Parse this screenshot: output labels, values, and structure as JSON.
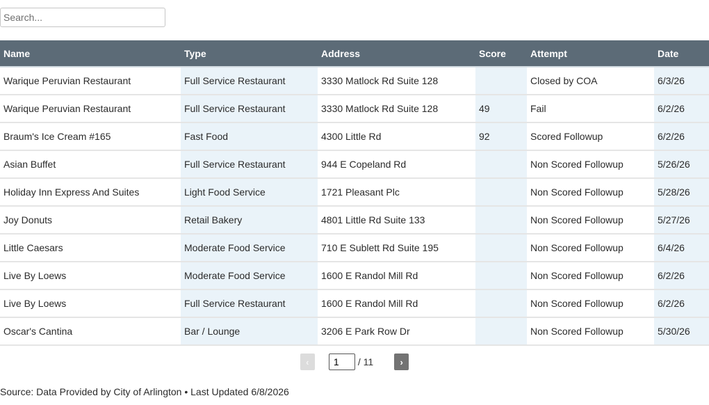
{
  "search": {
    "placeholder": "Search..."
  },
  "table": {
    "headers": [
      "Name",
      "Type",
      "Address",
      "Score",
      "Attempt",
      "Date"
    ],
    "rows": [
      [
        "Warique Peruvian Restaurant",
        "Full Service Restaurant",
        "3330 Matlock Rd Suite 128",
        "",
        "Closed by COA",
        "6/3/26"
      ],
      [
        "Warique Peruvian Restaurant",
        "Full Service Restaurant",
        "3330 Matlock Rd Suite 128",
        "49",
        "Fail",
        "6/2/26"
      ],
      [
        "Braum's Ice Cream #165",
        "Fast Food",
        "4300 Little Rd",
        "92",
        "Scored Followup",
        "6/2/26"
      ],
      [
        "Asian Buffet",
        "Full Service Restaurant",
        "944 E Copeland Rd",
        "",
        "Non Scored Followup",
        "5/26/26"
      ],
      [
        "Holiday Inn Express And Suites",
        "Light Food Service",
        "1721 Pleasant Plc",
        "",
        "Non Scored Followup",
        "5/28/26"
      ],
      [
        "Joy Donuts",
        "Retail Bakery",
        "4801 Little Rd Suite 133",
        "",
        "Non Scored Followup",
        "5/27/26"
      ],
      [
        "Little Caesars",
        "Moderate Food Service",
        "710 E Sublett Rd Suite 195",
        "",
        "Non Scored Followup",
        "6/4/26"
      ],
      [
        "Live By Loews",
        "Moderate Food Service",
        "1600 E Randol Mill Rd",
        "",
        "Non Scored Followup",
        "6/2/26"
      ],
      [
        "Live By Loews",
        "Full Service Restaurant",
        "1600 E Randol Mill Rd",
        "",
        "Non Scored Followup",
        "6/2/26"
      ],
      [
        "Oscar's Cantina",
        "Bar / Lounge",
        "3206 E Park Row Dr",
        "",
        "Non Scored Followup",
        "5/30/26"
      ]
    ]
  },
  "pagination": {
    "prev_label": "‹",
    "next_label": "›",
    "current_page": "1",
    "total_label": "/ 11"
  },
  "footer": {
    "source": "Source: Data Provided by City of Arlington • Last Updated 6/8/2026"
  },
  "colors": {
    "header_bg": "#5c6b77",
    "shaded_column": "#eaf3f9"
  }
}
